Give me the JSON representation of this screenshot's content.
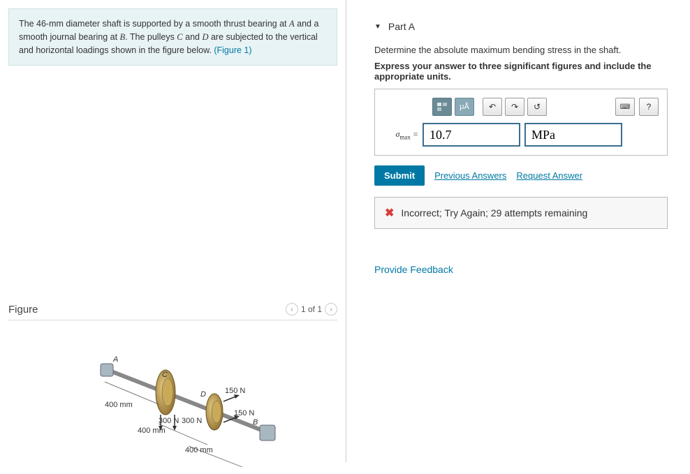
{
  "problem": {
    "text_prefix": "The 46-mm diameter shaft is supported by a smooth thrust bearing at ",
    "A": "A",
    "mid1": " and a smooth journal bearing at ",
    "B": "B",
    "mid2": ". The pulleys ",
    "C": "C",
    "mid3": " and ",
    "D": "D",
    "text_suffix": " are subjected to the vertical and horizontal loadings shown in the figure below. ",
    "figure_link": "(Figure 1)"
  },
  "figure": {
    "title": "Figure",
    "counter": "1 of 1",
    "labels": {
      "A": "A",
      "B": "B",
      "C": "C",
      "D": "D",
      "d400_1": "400 mm",
      "d400_2": "400 mm",
      "d400_3": "400 mm",
      "f300_1": "300 N",
      "f300_2": "300 N",
      "f150_1": "150 N",
      "f150_2": "150 N"
    }
  },
  "part": {
    "header_label": "Part A",
    "instruction1": "Determine the absolute maximum bending stress in the shaft.",
    "instruction2": "Express your answer to three significant figures and include the appropriate units.",
    "sigma_prefix": "σ",
    "sigma_sub": "max",
    "equals": " = ",
    "value": "10.7",
    "unit": "MPa",
    "units_btn": "μÅ",
    "help_btn": "?",
    "submit": "Submit",
    "prev_answers": "Previous Answers",
    "request_answer": "Request Answer"
  },
  "feedback": {
    "text": "Incorrect; Try Again; 29 attempts remaining"
  },
  "provide_feedback": "Provide Feedback"
}
